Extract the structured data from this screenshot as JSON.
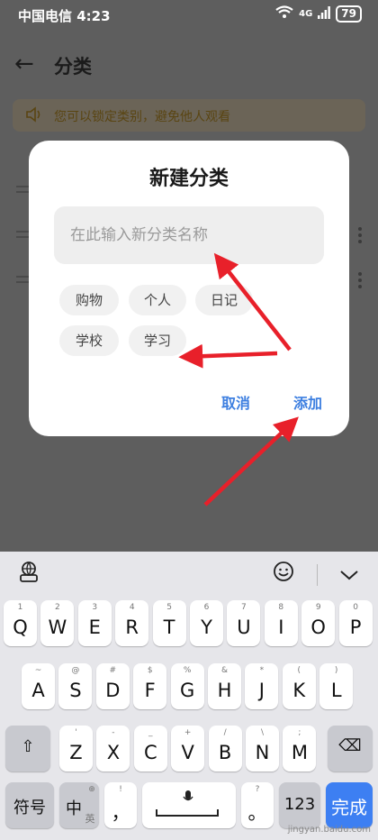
{
  "status_bar": {
    "carrier_time": "中国电信 4:23",
    "network": "4G",
    "battery": "79"
  },
  "header": {
    "title": "分类"
  },
  "tip": {
    "text": "您可以锁定类别，避免他人观看"
  },
  "dialog": {
    "title": "新建分类",
    "input_placeholder": "在此输入新分类名称",
    "chips": [
      "购物",
      "个人",
      "日记",
      "学校",
      "学习"
    ],
    "cancel_label": "取消",
    "add_label": "添加"
  },
  "keyboard": {
    "row1": [
      {
        "k": "Q",
        "h": "1"
      },
      {
        "k": "W",
        "h": "2"
      },
      {
        "k": "E",
        "h": "3"
      },
      {
        "k": "R",
        "h": "4"
      },
      {
        "k": "T",
        "h": "5"
      },
      {
        "k": "Y",
        "h": "6"
      },
      {
        "k": "U",
        "h": "7"
      },
      {
        "k": "I",
        "h": "8"
      },
      {
        "k": "O",
        "h": "9"
      },
      {
        "k": "P",
        "h": "0"
      }
    ],
    "row2": [
      {
        "k": "A",
        "h": "~"
      },
      {
        "k": "S",
        "h": "@"
      },
      {
        "k": "D",
        "h": "#"
      },
      {
        "k": "F",
        "h": "$"
      },
      {
        "k": "G",
        "h": "%"
      },
      {
        "k": "H",
        "h": "&"
      },
      {
        "k": "J",
        "h": "*"
      },
      {
        "k": "K",
        "h": "("
      },
      {
        "k": "L",
        "h": ")"
      }
    ],
    "row3": [
      {
        "k": "Z",
        "h": "'"
      },
      {
        "k": "X",
        "h": "-"
      },
      {
        "k": "C",
        "h": "_"
      },
      {
        "k": "V",
        "h": "+"
      },
      {
        "k": "B",
        "h": "/"
      },
      {
        "k": "N",
        "h": "\\"
      },
      {
        "k": "M",
        "h": ";"
      }
    ],
    "symbol_label": "符号",
    "lang_label": "中",
    "lang_sub": "英",
    "comma": "，",
    "period": "。",
    "num_label": "123",
    "done_label": "完成",
    "watermark": "jingyan.baidu.com"
  },
  "colors": {
    "accent": "#3d7fe0",
    "arrow": "#e8202a",
    "dim_overlay": "#5e5e5e"
  }
}
